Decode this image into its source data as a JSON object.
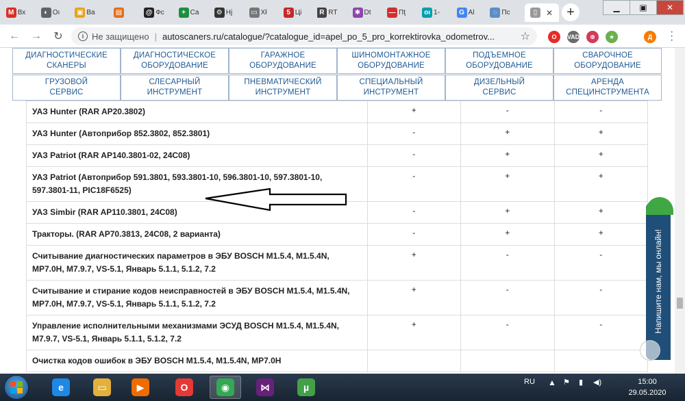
{
  "browser": {
    "tabs": [
      {
        "short": "Вх",
        "icon": "gmail-icon",
        "color": "#d93025",
        "glyph": "M"
      },
      {
        "short": "Oı",
        "icon": "globe-icon",
        "color": "#5f6368",
        "glyph": "◐"
      },
      {
        "short": "Ba",
        "icon": "gift-icon",
        "color": "#e8a317",
        "glyph": "▣"
      },
      {
        "short": "",
        "icon": "car-icon",
        "color": "#e36f1e",
        "glyph": "▤"
      },
      {
        "short": "Фс",
        "icon": "drive2-icon",
        "color": "#222222",
        "glyph": "@"
      },
      {
        "short": "Ca",
        "icon": "sheets-icon",
        "color": "#1e8e3e",
        "glyph": "+"
      },
      {
        "short": "Нj",
        "icon": "gear-icon",
        "color": "#333333",
        "glyph": "⚙"
      },
      {
        "short": "Xł",
        "icon": "scanner-icon",
        "color": "#777777",
        "glyph": "▭"
      },
      {
        "short": "Цi",
        "icon": "5v-icon",
        "color": "#c62828",
        "glyph": "5"
      },
      {
        "short": "RT",
        "icon": "tools-icon",
        "color": "#444444",
        "glyph": "R"
      },
      {
        "short": "Dt",
        "icon": "puzzle-icon",
        "color": "#8e44ad",
        "glyph": "✱"
      },
      {
        "short": "Пţ",
        "icon": "stop-icon",
        "color": "#d32f2f",
        "glyph": "—"
      },
      {
        "short": "1-",
        "icon": "ok-icon",
        "color": "#00a0b0",
        "glyph": "oı"
      },
      {
        "short": "Al",
        "icon": "google-icon",
        "color": "#4285f4",
        "glyph": "G"
      },
      {
        "short": "Пс",
        "icon": "loading-icon",
        "color": "#5c8dc5",
        "glyph": "◌"
      }
    ],
    "active_tab": {
      "icon": "page-icon",
      "close": "✕"
    },
    "new_tab": "+",
    "window_controls": {
      "minimize": "▁",
      "maximize": "▣",
      "close": "✕"
    },
    "address": {
      "security": "Не защищено",
      "separator": "|",
      "url": "autoscaners.ru/catalogue/?catalogue_id=apel_po_5_pro_korrektirovka_odometrov..."
    },
    "extensions": [
      {
        "label": "O",
        "color": "#e52d27",
        "icon": "opera-icon"
      },
      {
        "label": "VAD",
        "color": "#6b6b6b",
        "icon": "vad-icon"
      },
      {
        "label": "⊕",
        "color": "#d33b5a",
        "icon": "savefrom-icon"
      },
      {
        "label": "★",
        "color": "#6ab04c",
        "icon": "addon-icon"
      },
      {
        "label": "Д",
        "color": "#f57c00",
        "icon": "profile-avatar-icon"
      }
    ]
  },
  "nav": {
    "row1": [
      "ДИАГНОСТИЧЕСКИЕ\nСКАНЕРЫ",
      "ДИАГНОСТИЧЕСКОЕ\nОБОРУДОВАНИЕ",
      "ГАРАЖНОЕ\nОБОРУДОВАНИЕ",
      "ШИНОМОНТАЖНОЕ\nОБОРУДОВАНИЕ",
      "ПОДЪЕМНОЕ\nОБОРУДОВАНИЕ",
      "СВАРОЧНОЕ\nОБОРУДОВАНИЕ"
    ],
    "row2": [
      "ГРУЗОВОЙ\nСЕРВИС",
      "СЛЕСАРНЫЙ\nИНСТРУМЕНТ",
      "ПНЕВМАТИЧЕСКИЙ\nИНСТРУМЕНТ",
      "СПЕЦИАЛЬНЫЙ\nИНСТРУМЕНТ",
      "ДИЗЕЛЬНЫЙ\nСЕРВИС",
      "АРЕНДА\nСПЕЦИНСТРУМЕНТА"
    ]
  },
  "table": {
    "rows": [
      {
        "name": "УАЗ Hunter (RAR AP20.3802)",
        "c1": "+",
        "c2": "-",
        "c3": "-"
      },
      {
        "name": "УАЗ Hunter (Автоприбор 852.3802, 852.3801)",
        "c1": "-",
        "c2": "+",
        "c3": "+"
      },
      {
        "name": "УАЗ Patriot (RAR AP140.3801-02, 24C08)",
        "c1": "-",
        "c2": "+",
        "c3": "+"
      },
      {
        "name": "УАЗ Patriot (Автоприбор 591.3801, 593.3801-10, 596.3801-10, 597.3801-10, 597.3801-11, PIC18F6525)",
        "c1": "-",
        "c2": "+",
        "c3": "+"
      },
      {
        "name": "УАЗ Simbir (RAR AP110.3801, 24C08)",
        "c1": "-",
        "c2": "+",
        "c3": "+"
      },
      {
        "name": "Тракторы. (RAR AP70.3813, 24C08, 2 варианта)",
        "c1": "-",
        "c2": "+",
        "c3": "+"
      },
      {
        "name": "Считывание диагностических параметров в ЭБУ BOSCH M1.5.4, M1.5.4N, MP7.0H, M7.9.7, VS-5.1, Январь 5.1.1, 5.1.2, 7.2",
        "c1": "+",
        "c2": "-",
        "c3": "-"
      },
      {
        "name": "Считывание и стирание кодов неисправностей в ЭБУ BOSCH M1.5.4, M1.5.4N, MP7.0H, M7.9.7, VS-5.1, Январь 5.1.1, 5.1.2, 7.2",
        "c1": "+",
        "c2": "-",
        "c3": "-"
      },
      {
        "name": "Управление исполнительными механизмами ЭСУД BOSCH M1.5.4, M1.5.4N, M7.9.7, VS-5.1, Январь 5.1.1, 5.1.2, 7.2",
        "c1": "+",
        "c2": "-",
        "c3": "-"
      },
      {
        "name": "Очистка кодов ошибок в ЭБУ BOSCH M1.5.4, M1.5.4N, MP7.0H",
        "c1": "",
        "c2": "",
        "c3": ""
      }
    ]
  },
  "chat": {
    "label": "Напишите нам, мы онлайн!"
  },
  "taskbar": {
    "lang": "RU",
    "time": "15:00",
    "date": "29.05.2020",
    "apps": [
      {
        "icon": "ie-icon",
        "color": "#1e88e5",
        "glyph": "e"
      },
      {
        "icon": "explorer-icon",
        "color": "#e2b03b",
        "glyph": "▭"
      },
      {
        "icon": "media-player-icon",
        "color": "#ef6c00",
        "glyph": "▶"
      },
      {
        "icon": "opera-icon",
        "color": "#e53935",
        "glyph": "O"
      },
      {
        "icon": "chrome-icon",
        "color": "#34a853",
        "glyph": "◉"
      },
      {
        "icon": "visual-studio-icon",
        "color": "#68217a",
        "glyph": "⋈"
      },
      {
        "icon": "utorrent-icon",
        "color": "#43a047",
        "glyph": "µ"
      }
    ]
  }
}
